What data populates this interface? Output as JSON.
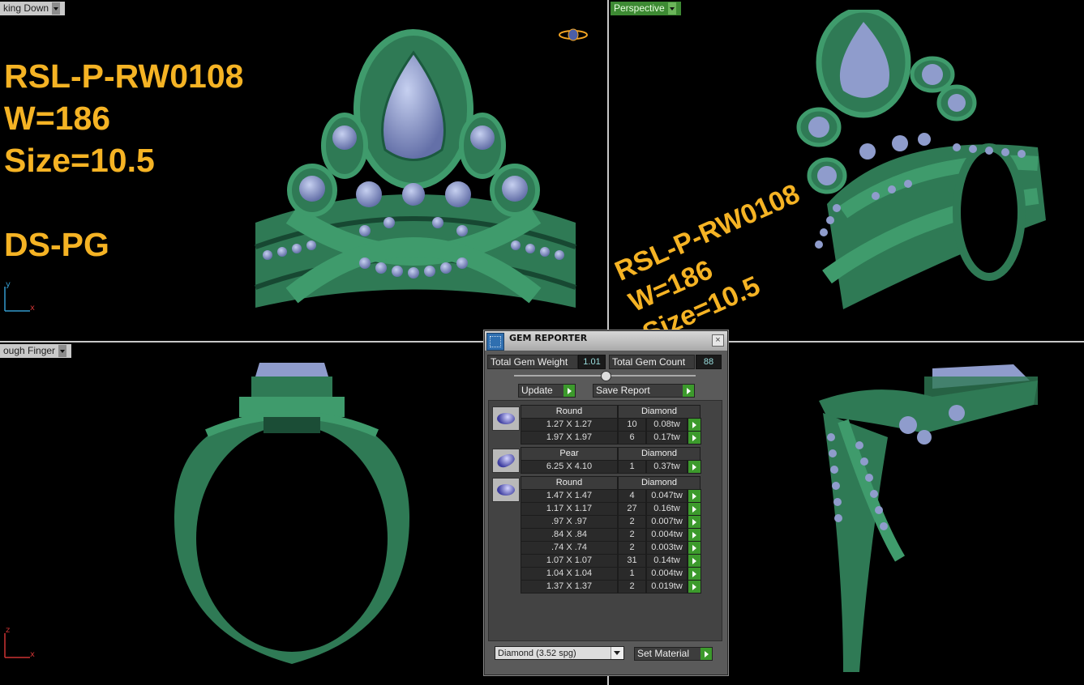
{
  "viewports": {
    "top_left": {
      "label": "king Down",
      "annotations": [
        "RSL-P-RW0108",
        "W=186",
        "Size=10.5",
        "",
        "DS-PG"
      ],
      "axis": [
        "y",
        "x"
      ]
    },
    "top_right": {
      "label": "Perspective",
      "annotations": [
        "RSL-P-RW0108",
        "W=186",
        "Size=10.5"
      ]
    },
    "bottom_left": {
      "label": "ough Finger",
      "axis": [
        "z",
        "x"
      ]
    },
    "bottom_right": {}
  },
  "gem_reporter": {
    "title": "GEM REPORTER",
    "close": "×",
    "total_weight_label": "Total Gem Weight",
    "total_weight_value": "1.01",
    "total_count_label": "Total Gem Count",
    "total_count_value": "88",
    "update_label": "Update",
    "save_report_label": "Save Report",
    "groups": [
      {
        "shape": "Round",
        "material": "Diamond",
        "icon": "round-gem-icon",
        "rows": [
          {
            "size": "1.27 X 1.27",
            "count": "10",
            "weight": "0.08tw"
          },
          {
            "size": "1.97 X 1.97",
            "count": "6",
            "weight": "0.17tw"
          }
        ]
      },
      {
        "shape": "Pear",
        "material": "Diamond",
        "icon": "pear-gem-icon",
        "rows": [
          {
            "size": "6.25 X 4.10",
            "count": "1",
            "weight": "0.37tw"
          }
        ]
      },
      {
        "shape": "Round",
        "material": "Diamond",
        "icon": "round-gem-icon",
        "rows": [
          {
            "size": "1.47 X 1.47",
            "count": "4",
            "weight": "0.047tw"
          },
          {
            "size": "1.17 X 1.17",
            "count": "27",
            "weight": "0.16tw"
          },
          {
            "size": ".97 X .97",
            "count": "2",
            "weight": "0.007tw"
          },
          {
            "size": ".84 X .84",
            "count": "2",
            "weight": "0.004tw"
          },
          {
            "size": ".74 X .74",
            "count": "2",
            "weight": "0.003tw"
          },
          {
            "size": "1.07 X 1.07",
            "count": "31",
            "weight": "0.14tw"
          },
          {
            "size": "1.04 X 1.04",
            "count": "1",
            "weight": "0.004tw"
          },
          {
            "size": "1.37 X 1.37",
            "count": "2",
            "weight": "0.019tw"
          }
        ]
      }
    ],
    "material_select": "Diamond      (3.52 spg)",
    "set_material_label": "Set Material"
  },
  "colors": {
    "ring_green": "#2f7a55",
    "gem_blue": "#8f9ccc",
    "annotation_orange": "#f5b324",
    "label_green": "#3d8a33"
  }
}
